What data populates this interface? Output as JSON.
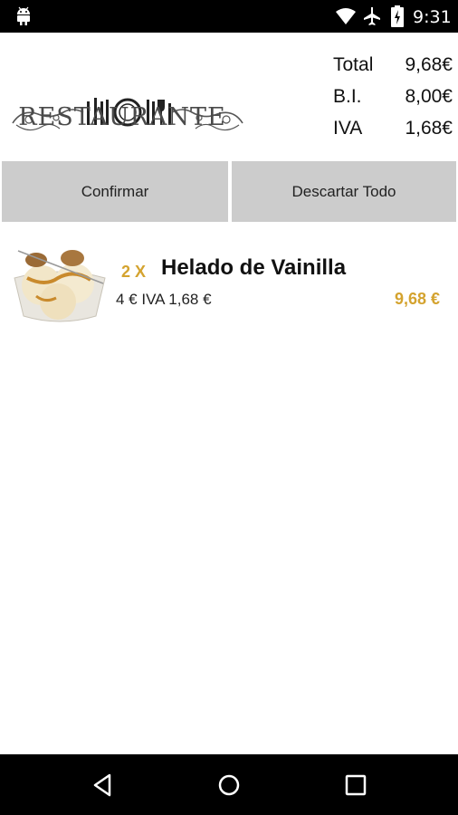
{
  "status_bar": {
    "time": "9:31",
    "icons": [
      "android-icon",
      "wifi-icon",
      "airplane-icon",
      "battery-icon"
    ]
  },
  "header": {
    "logo_text": "RESTAURANTE",
    "totals": [
      {
        "label": "Total",
        "value": "9,68€"
      },
      {
        "label": "B.I.",
        "value": "8,00€"
      },
      {
        "label": "IVA",
        "value": "1,68€"
      }
    ]
  },
  "actions": {
    "confirm_label": "Confirmar",
    "discard_label": "Descartar Todo"
  },
  "order_items": [
    {
      "quantity": "2 X",
      "name": "Helado de Vainilla",
      "detail": "4 € IVA 1,68 €",
      "price": "9,68 €"
    }
  ],
  "colors": {
    "accent": "#d4a32f",
    "button_bg": "#cccccc",
    "bars": "#000000"
  },
  "nav_bar": {
    "icons": [
      "back-icon",
      "home-icon",
      "recents-icon"
    ]
  }
}
